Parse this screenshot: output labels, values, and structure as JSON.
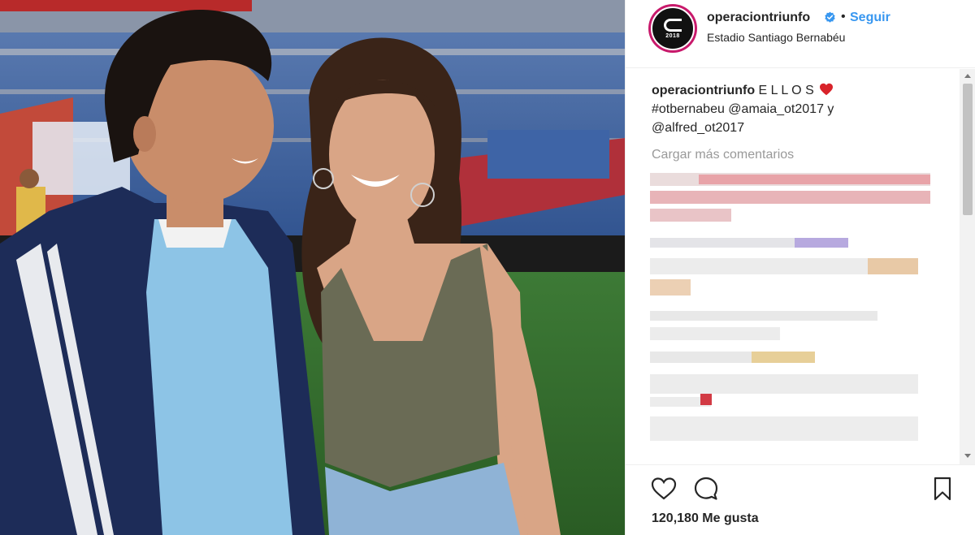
{
  "post": {
    "username": "operaciontriunfo",
    "follow_label": "Seguir",
    "separator": "•",
    "location": "Estadio Santiago Bernabéu",
    "avatar_text": "2018"
  },
  "caption": {
    "user": "operaciontriunfo",
    "line1": " E L L O S ",
    "line2": "#otbernabeu @amaia_ot2017 y",
    "line3": "@alfred_ot2017"
  },
  "comments": {
    "load_more_label": "Cargar más comentarios",
    "blurred": true
  },
  "actions": {
    "likes_text": "120,180 Me gusta"
  },
  "colors": {
    "link_blue": "#3897f0",
    "heart_red": "#ed4956",
    "verified_blue": "#3897f0",
    "text": "#262626",
    "muted": "#999999"
  },
  "icons": [
    "verified-badge-icon",
    "heart-icon",
    "comment-icon",
    "bookmark-icon"
  ]
}
